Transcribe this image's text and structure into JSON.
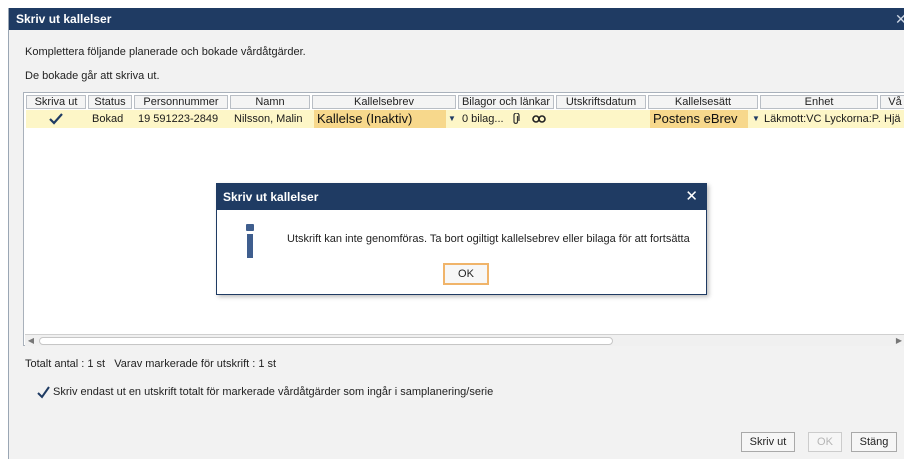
{
  "window": {
    "title": "Skriv ut kallelser",
    "close_glyph": "✕"
  },
  "intro": {
    "line1": "Komplettera följande planerade och bokade vårdåtgärder.",
    "line2": "De bokade går att skriva ut."
  },
  "table": {
    "columns": [
      "Skriva ut",
      "Status",
      "Personnummer",
      "Namn",
      "Kallelsebrev",
      "Bilagor och länkar",
      "Utskriftsdatum",
      "Kallelsesätt",
      "Enhet",
      "Vå"
    ],
    "row": {
      "print_checked": true,
      "status": "Bokad",
      "personnummer": "19 591223-2849",
      "name": "Nilsson, Malin",
      "kallelsebrev": "Kallelse (Inaktiv)",
      "bilagor": "0 bilag...",
      "utskriftsdatum": "",
      "kallelsesatt": "Postens eBrev",
      "enhet": "Läkmott:VC Lyckorna:P...",
      "va": "Hjä"
    }
  },
  "dialog": {
    "title": "Skriv ut kallelser",
    "close_glyph": "✕",
    "message": "Utskrift kan inte genomföras. Ta bort ogiltigt kallelsebrev eller bilaga för att fortsätta",
    "ok_label": "OK"
  },
  "summary": {
    "totals": "Totalt antal : 1 st",
    "selected": "Varav markerade för utskrift : 1 st"
  },
  "option": {
    "checked": true,
    "label": "Skriv endast ut en utskrift totalt för markerade vårdåtgärder som ingår i samplanering/serie"
  },
  "buttons": {
    "print": "Skriv ut",
    "ok": "OK",
    "close": "Stäng"
  },
  "colors": {
    "titlebar": "#1f3b63",
    "row_highlight": "#fdf6c7",
    "dropdown": "#f7d88c",
    "ok_border": "#f0b46a"
  },
  "icons": [
    "close-icon",
    "checkmark-icon",
    "dropdown-arrow-icon",
    "paperclip-icon",
    "link-icon",
    "info-icon",
    "scroll-left-icon",
    "scroll-right-icon"
  ]
}
